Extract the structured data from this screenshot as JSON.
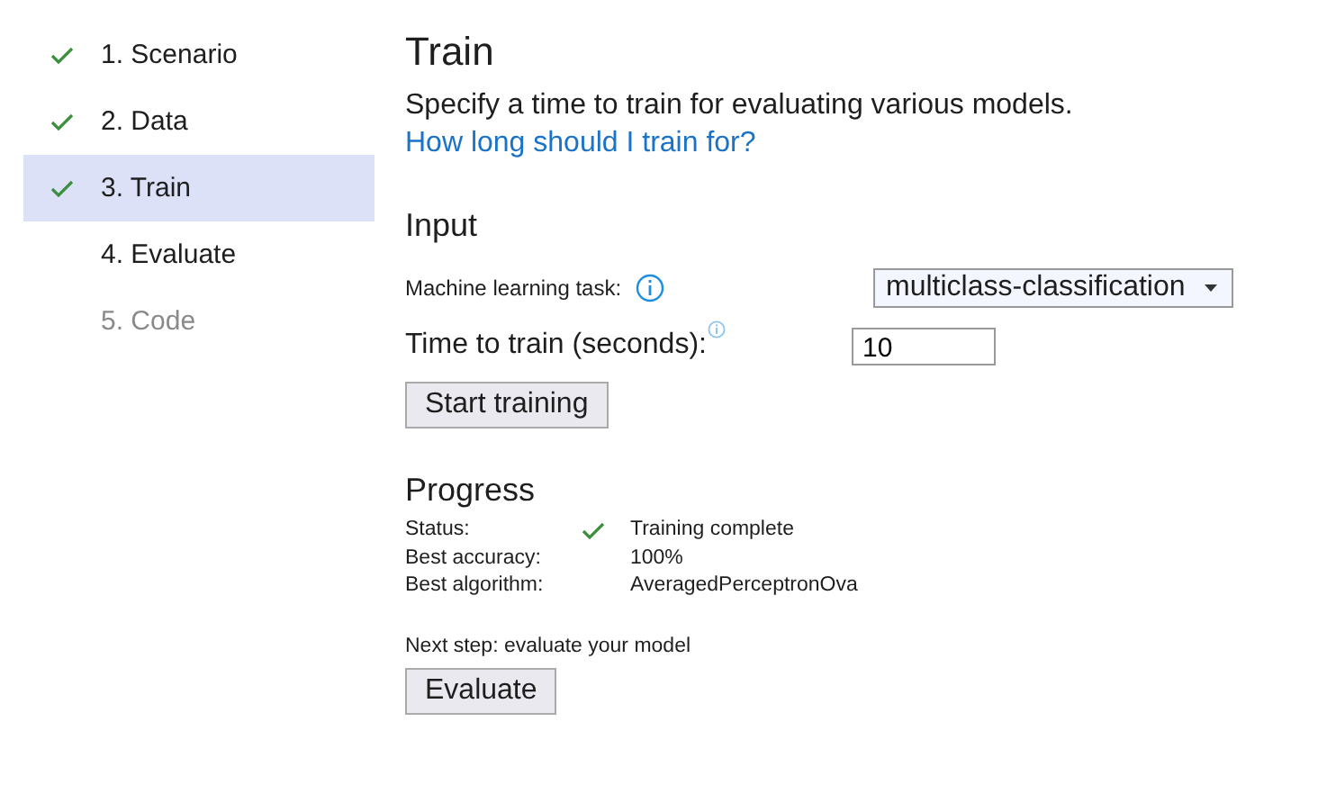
{
  "steps": [
    {
      "label": "1. Scenario",
      "checked": true,
      "selected": false,
      "disabled": false
    },
    {
      "label": "2. Data",
      "checked": true,
      "selected": false,
      "disabled": false
    },
    {
      "label": "3. Train",
      "checked": true,
      "selected": true,
      "disabled": false
    },
    {
      "label": "4. Evaluate",
      "checked": false,
      "selected": false,
      "disabled": false
    },
    {
      "label": "5. Code",
      "checked": false,
      "selected": false,
      "disabled": true
    }
  ],
  "title": "Train",
  "description": "Specify a time to train for evaluating various models.",
  "help_link": "How long should I train for?",
  "input": {
    "heading": "Input",
    "task_label": "Machine learning task:",
    "task_value": "multiclass-classification",
    "time_label": "Time to train (seconds):",
    "time_value": "10",
    "start_button": "Start training"
  },
  "progress": {
    "heading": "Progress",
    "rows": [
      {
        "kind": "status",
        "label": "Status:",
        "value": "Training complete"
      },
      {
        "kind": "text",
        "label": "Best accuracy:",
        "value": "100%"
      },
      {
        "kind": "text",
        "label": "Best algorithm:",
        "value": "AveragedPerceptronOva"
      }
    ],
    "next_step": "Next step: evaluate your model",
    "evaluate_button": "Evaluate"
  }
}
